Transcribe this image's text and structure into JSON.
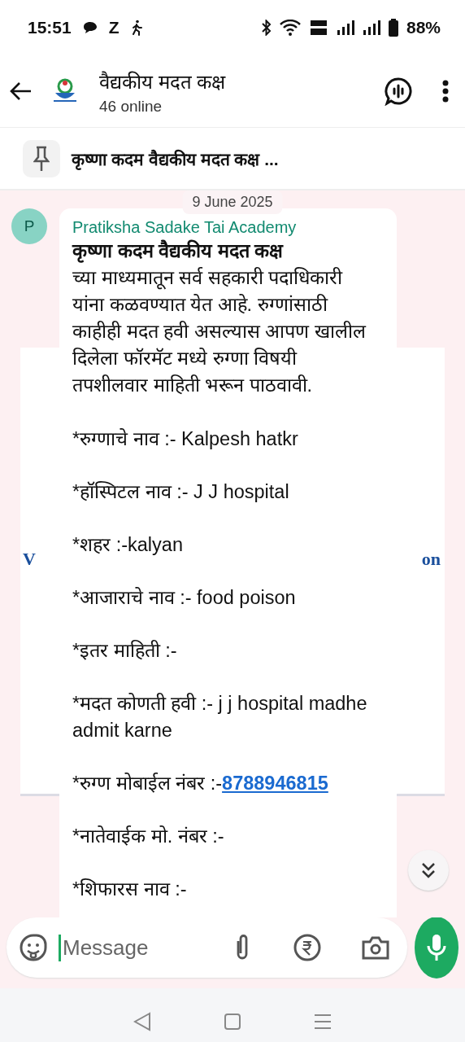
{
  "status_bar": {
    "time": "15:51",
    "notification_letter": "Z",
    "battery": "88%"
  },
  "header": {
    "title": "वैद्यकीय मदत कक्ष",
    "subtitle": "46 online"
  },
  "pinned": {
    "text": "कृष्णा कदम वैद्यकीय मदत कक्ष ..."
  },
  "date_chip": "9 June 2025",
  "background_card": {
    "fragment_left": "V",
    "fragment_right": "on"
  },
  "message": {
    "avatar_letter": "P",
    "sender": "Pratiksha Sadake Tai Academy",
    "title": "कृष्णा कदम वैद्यकीय मदत कक्ष",
    "paragraphs": [
      {
        "text": "च्या माध्यमातून सर्व सहकारी पदाधिकारी यांना कळवण्यात येत आहे. रुग्णांसाठी काहीही मदत हवी असल्यास आपण खालील दिलेला फॉरमॅट मध्ये रुग्णा विषयी तपशीलवार माहिती भरून पाठवावी."
      },
      {
        "text": "*रुग्णाचे नाव :- Kalpesh hatkr"
      },
      {
        "text": "*हॉस्पिटल नाव :- J J hospital"
      },
      {
        "text": "*शहर :-kalyan"
      },
      {
        "text": "*आजाराचे नाव :- food poison"
      },
      {
        "text": "*इतर माहिती :-"
      },
      {
        "text": "*मदत कोणती हवी :- j j hospital madhe admit karne"
      },
      {
        "text": "*रुग्ण मोबाईल नंबर :-",
        "link": "8788946815"
      },
      {
        "text": "*नातेवाईक मो. नंबर :-"
      },
      {
        "text": "*शिफारस नाव :-"
      }
    ]
  },
  "composer": {
    "placeholder": "Message"
  }
}
